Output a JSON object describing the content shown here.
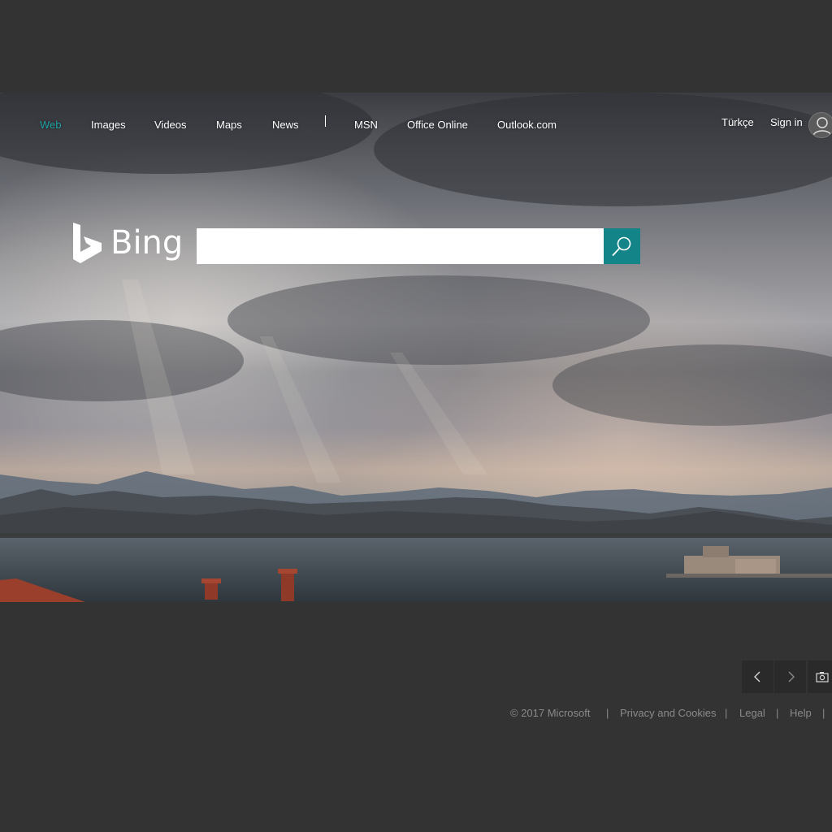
{
  "nav": {
    "items": [
      "Web",
      "Images",
      "Videos",
      "Maps",
      "News",
      "MSN",
      "Office Online",
      "Outlook.com"
    ],
    "active_color": "#1fa0a2"
  },
  "user": {
    "language": "Türkçe",
    "sign_in": "Sign in",
    "avatar_icon": "user-silhouette-icon"
  },
  "brand": {
    "logo_text": "Bing",
    "logo_icon": "bing-b-icon"
  },
  "search": {
    "value": "",
    "placeholder": "",
    "button_icon": "search-icon",
    "button_color": "#138487"
  },
  "image_controls": {
    "prev_icon": "chevron-left-icon",
    "next_icon": "chevron-right-icon",
    "camera_icon": "camera-icon"
  },
  "footer": {
    "copyright": "© 2017 Microsoft",
    "links": [
      "Privacy and Cookies",
      "Legal",
      "Help"
    ],
    "separator": "|"
  },
  "colors": {
    "page_background": "#333333",
    "footer_text": "#8a8a8a"
  }
}
